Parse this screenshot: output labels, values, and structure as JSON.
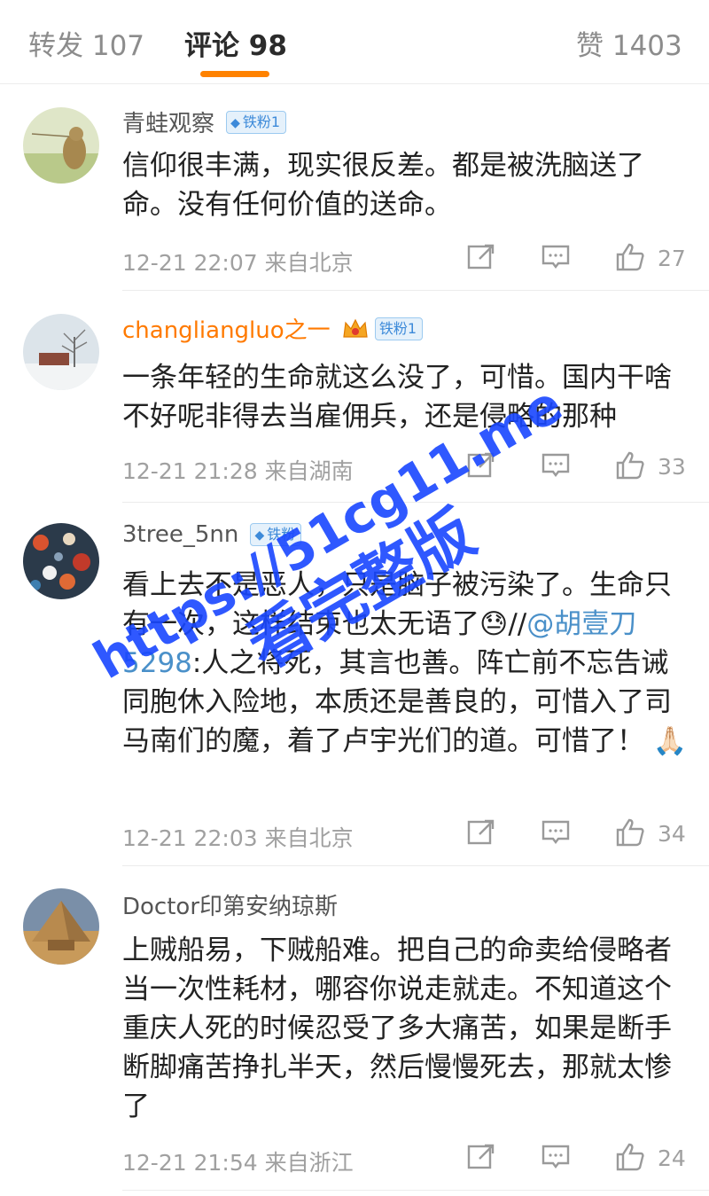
{
  "tabs": [
    {
      "label": "转发 107"
    },
    {
      "label": "评论 98"
    },
    {
      "label": "赞 1403"
    }
  ],
  "accent_color": "#ff8200",
  "comments": [
    {
      "username": "青蛙观察",
      "badge": "铁粉1",
      "body": "信仰很丰满，现实很反差。都是被洗脑送了命。没有任何价值的送命。",
      "time": "12-21 22:07 来自北京",
      "likes": "27"
    },
    {
      "username": "changliangluo之一",
      "badge": "铁粉1",
      "body": "一条年轻的生命就这么没了，可惜。国内干啥不好呢非得去当雇佣兵，还是侵略的那种",
      "time": "12-21 21:28 来自湖南",
      "likes": "33"
    },
    {
      "username": "3tree_5nn",
      "badge": "铁粉",
      "body_before": "看上去不是恶人，只是脑子被污染了。生命只有一次，这样结束也太无语了😓//",
      "mention": "@胡壹刀5298",
      "body_after": ":人之将死，其言也善。阵亡前不忘告诫同胞休入险地，本质还是善良的，可惜入了司马南们的魔，着了卢宇光们的道。可惜了！ 🙏🏻",
      "time": "12-21 22:03 来自北京",
      "likes": "34"
    },
    {
      "username": "Doctor印第安纳琼斯",
      "body": "上贼船易，下贼船难。把自己的命卖给侵略者当一次性耗材，哪容你说走就走。不知道这个重庆人死的时候忍受了多大痛苦，如果是断手断脚痛苦挣扎半天，然后慢慢死去，那就太惨了",
      "time": "12-21 21:54 来自浙江",
      "likes": "24"
    }
  ],
  "watermark": {
    "line1": "https://51cg11.me",
    "line2": "看完整版"
  }
}
